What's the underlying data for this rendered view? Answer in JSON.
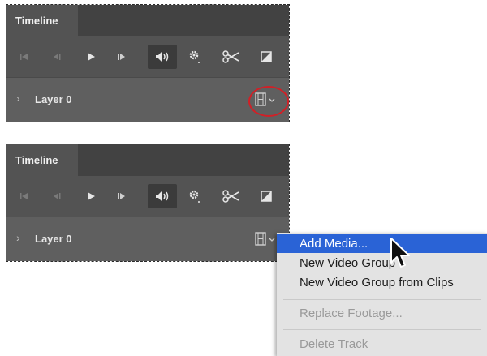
{
  "panels": [
    {
      "tab_label": "Timeline",
      "layer_name": "Layer 0",
      "highlighted_control": "add-media-dropdown"
    },
    {
      "tab_label": "Timeline",
      "layer_name": "Layer 0"
    }
  ],
  "toolbar_icons": [
    "go-to-first-frame-icon",
    "previous-frame-icon",
    "play-icon",
    "next-frame-icon",
    "audio-icon",
    "settings-gear-icon",
    "split-scissors-icon",
    "transition-icon"
  ],
  "context_menu": {
    "items": [
      {
        "label": "Add Media...",
        "state": "highlighted"
      },
      {
        "label": "New Video Group",
        "state": "enabled"
      },
      {
        "label": "New Video Group from Clips",
        "state": "enabled"
      },
      {
        "label": "Replace Footage...",
        "state": "disabled"
      },
      {
        "label": "Delete Track",
        "state": "disabled"
      }
    ]
  },
  "colors": {
    "panel": "#5a5a5a",
    "tab_bar": "#424242",
    "menu_highlight": "#2a63d6",
    "callout_ring": "#d21f26"
  }
}
